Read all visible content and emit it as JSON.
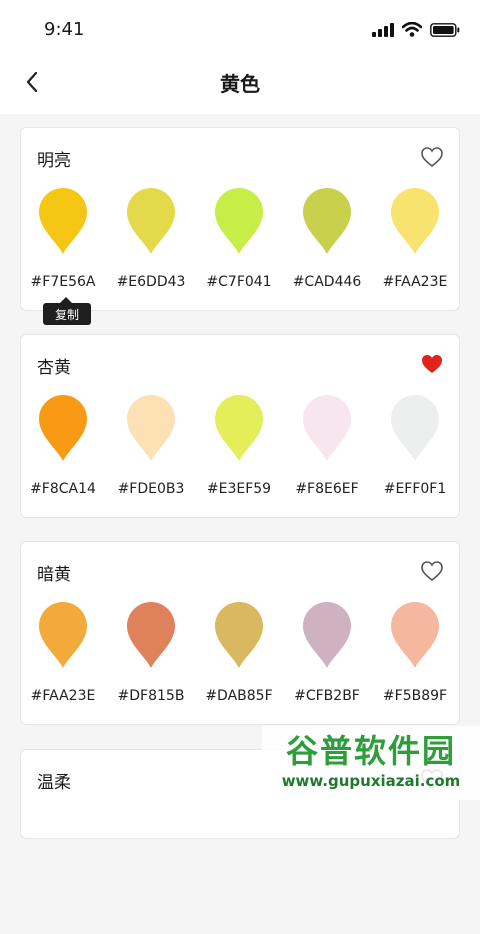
{
  "status": {
    "time": "9:41"
  },
  "header": {
    "title": "黄色"
  },
  "tooltip": {
    "label": "复制"
  },
  "palettes": [
    {
      "name": "明亮",
      "favorited": false,
      "colors": [
        {
          "hex": "#F7E56A",
          "fill": "#F5C614"
        },
        {
          "hex": "#E6DD43",
          "fill": "#E4D94A"
        },
        {
          "hex": "#C7F041",
          "fill": "#C6EE46"
        },
        {
          "hex": "#CAD446",
          "fill": "#C9D04B"
        },
        {
          "hex": "#FAA23E",
          "fill": "#F8E36E"
        }
      ]
    },
    {
      "name": "杏黄",
      "favorited": true,
      "colors": [
        {
          "hex": "#F8CA14",
          "fill": "#F99A14"
        },
        {
          "hex": "#FDE0B3",
          "fill": "#FDE0B3"
        },
        {
          "hex": "#E3EF59",
          "fill": "#E3EF59"
        },
        {
          "hex": "#F8E6EF",
          "fill": "#F8E6EF"
        },
        {
          "hex": "#EFF0F1",
          "fill": "#EDEFEE"
        }
      ]
    },
    {
      "name": "暗黄",
      "favorited": false,
      "colors": [
        {
          "hex": "#FAA23E",
          "fill": "#F2AB3A"
        },
        {
          "hex": "#DF815B",
          "fill": "#DF815B"
        },
        {
          "hex": "#DAB85F",
          "fill": "#DAB85F"
        },
        {
          "hex": "#CFB2BF",
          "fill": "#CFB2BF"
        },
        {
          "hex": "#F5B89F",
          "fill": "#F5B89F"
        }
      ]
    },
    {
      "name": "温柔",
      "favorited": false,
      "colors": []
    }
  ],
  "watermark": {
    "title": "谷普软件园",
    "url": "www.gupuxiazai.com"
  },
  "colors": {
    "favorite": "#E2231A",
    "icon": "#555555"
  }
}
